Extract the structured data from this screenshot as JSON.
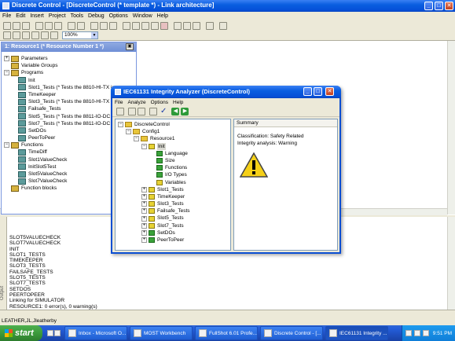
{
  "app": {
    "title": "Discrete Control - [DiscreteControl (* template *) - Link architecture]"
  },
  "menu": [
    "File",
    "Edit",
    "Insert",
    "Project",
    "Tools",
    "Debug",
    "Options",
    "Window",
    "Help"
  ],
  "toolbar": {
    "zoom": "100%"
  },
  "resource_window": {
    "title": "1: Resource1 (* Resource Number 1 *)"
  },
  "tree": [
    {
      "label": "Parameters",
      "icon": "book"
    },
    {
      "label": "Variable Groups",
      "icon": "book"
    },
    {
      "label": "Programs",
      "icon": "book"
    },
    {
      "label": "Init",
      "icon": "prog"
    },
    {
      "label": "Slot1_Tests (* Tests the 8810-HI-TX in",
      "icon": "prog"
    },
    {
      "label": "TimeKeeper",
      "icon": "prog"
    },
    {
      "label": "Slot3_Tests (* Tests the 8810-HI-TX in",
      "icon": "prog"
    },
    {
      "label": "Failsafe_Tests",
      "icon": "prog"
    },
    {
      "label": "Slot5_Tests (* Tests the 8811-IO-DC in",
      "icon": "prog"
    },
    {
      "label": "Slot7_Tests (* Tests the 8811-IO-DC in",
      "icon": "prog"
    },
    {
      "label": "SetDOs",
      "icon": "prog"
    },
    {
      "label": "PeerToPeer",
      "icon": "prog"
    },
    {
      "label": "Functions",
      "icon": "book"
    },
    {
      "label": "TimeDiff",
      "icon": "prog"
    },
    {
      "label": "Slot1ValueCheck",
      "icon": "prog"
    },
    {
      "label": "InitSlot5Test",
      "icon": "prog"
    },
    {
      "label": "Slot5ValueCheck",
      "icon": "prog"
    },
    {
      "label": "Slot7ValueCheck",
      "icon": "prog"
    },
    {
      "label": "Function blocks",
      "icon": "book"
    }
  ],
  "analyzer": {
    "title": "IEC61131 Integrity Analyzer (DiscreteControl)",
    "menu": [
      "File",
      "Analyze",
      "Options",
      "Help"
    ],
    "summary_header": "Summary",
    "classification": "Classification: Safety Related",
    "integrity": "Integrity analysis: Warning",
    "tree": [
      "DiscreteControl",
      "Config1",
      "Resource1",
      "Init",
      "Language",
      "Size",
      "Functions",
      "I/O Types",
      "Variables",
      "Slot1_Tests",
      "TimeKeeper",
      "Slot3_Tests",
      "Failsafe_Tests",
      "Slot5_Tests",
      "Slot7_Tests",
      "SetDOs",
      "PeerToPeer"
    ]
  },
  "output": [
    "SLOT5VALUECHECK",
    "SLOT7VALUECHECK",
    "INIT",
    "SLOT1_TESTS",
    "TIMEKEEPER",
    "SLOT3_TESTS",
    "FAILSAFE_TESTS",
    "SLOT5_TESTS",
    "SLOT7_TESTS",
    "SETDOS",
    "PEERTOPEER",
    "Linking for SIMULATOR",
    "RESOURCE1:     0 error(s), 0 warning(s)"
  ],
  "output_side_label": "Output",
  "status": {
    "text": "LEATHER,JL,Jleatherby"
  },
  "taskbar": {
    "start": "start",
    "items": [
      "Inbox - Microsoft O...",
      "MOST Workbench",
      "FullShot 6.01 Profe...",
      "Discrete Control - [...",
      "IEC61131 Integrity ..."
    ],
    "clock": "9:51 PM"
  },
  "colors": {
    "xp_blue": "#0a5ee0",
    "taskbar": "#245edb",
    "start_green": "#3c9a3c",
    "dialog_bg": "#ece9d8",
    "warning_yellow": "#f5d018"
  }
}
